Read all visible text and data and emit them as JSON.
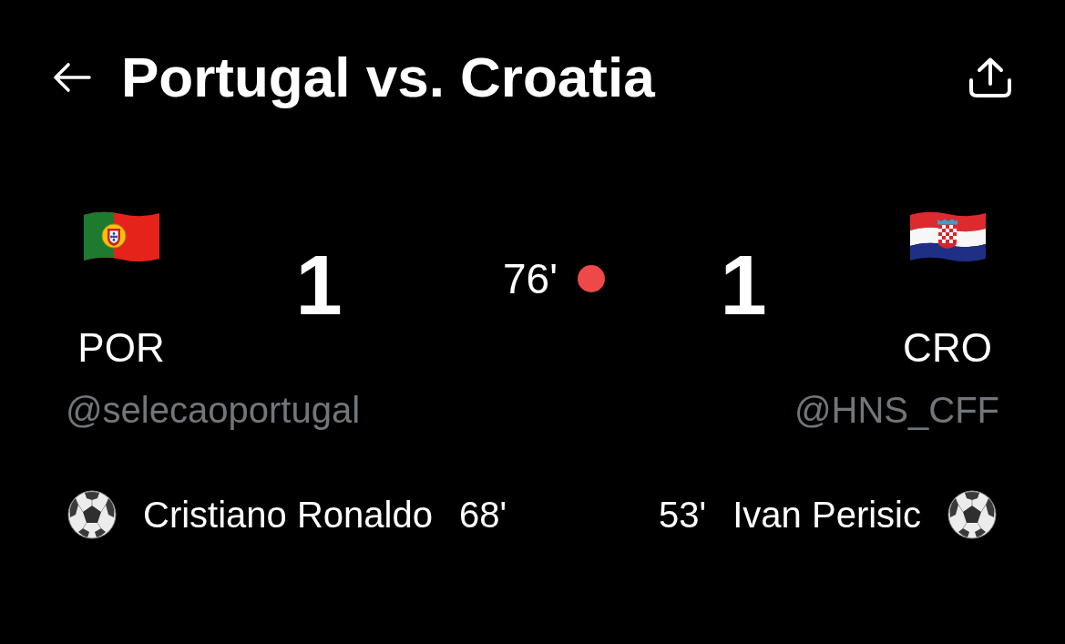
{
  "header": {
    "title": "Portugal vs. Croatia"
  },
  "match": {
    "clock": "76'",
    "live": true,
    "teams": [
      {
        "code": "POR",
        "score": "1",
        "handle": "@selecaoportugal",
        "goals": [
          {
            "player": "Cristiano Ronaldo",
            "minute": "68'"
          }
        ]
      },
      {
        "code": "CRO",
        "score": "1",
        "handle": "@HNS_CFF",
        "goals": [
          {
            "player": "Ivan Perisic",
            "minute": "53'"
          }
        ]
      }
    ]
  }
}
